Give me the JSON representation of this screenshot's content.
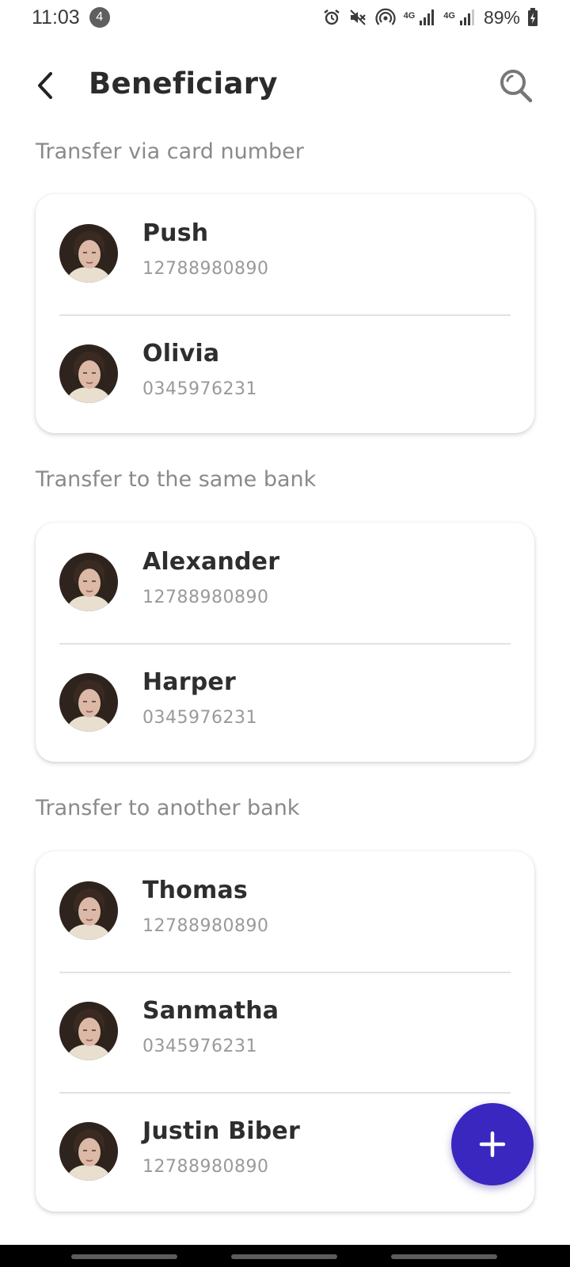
{
  "status_bar": {
    "time": "11:03",
    "notification_count": "4",
    "network_1": "4G",
    "network_2": "4G",
    "battery": "89%",
    "icons": [
      "alarm-icon",
      "mute-icon",
      "hotspot-icon",
      "signal-icon",
      "signal-icon",
      "battery-charging-icon"
    ]
  },
  "header": {
    "title": "Beneficiary",
    "back_icon": "back-arrow-icon",
    "search_icon": "search-icon"
  },
  "sections": [
    {
      "title": "Transfer via card number",
      "items": [
        {
          "name": "Push",
          "account": "12788980890"
        },
        {
          "name": "Olivia",
          "account": "0345976231"
        }
      ]
    },
    {
      "title": "Transfer to the same bank",
      "items": [
        {
          "name": "Alexander",
          "account": "12788980890"
        },
        {
          "name": "Harper",
          "account": "0345976231"
        }
      ]
    },
    {
      "title": "Transfer to another bank",
      "items": [
        {
          "name": "Thomas",
          "account": "12788980890"
        },
        {
          "name": "Sanmatha",
          "account": "0345976231"
        },
        {
          "name": "Justin Biber",
          "account": "12788980890"
        }
      ]
    }
  ],
  "fab": {
    "icon": "plus-icon"
  },
  "colors": {
    "accent": "#3a27c0",
    "title_text": "#2b2b2b",
    "secondary_text": "#8a8a8a"
  }
}
